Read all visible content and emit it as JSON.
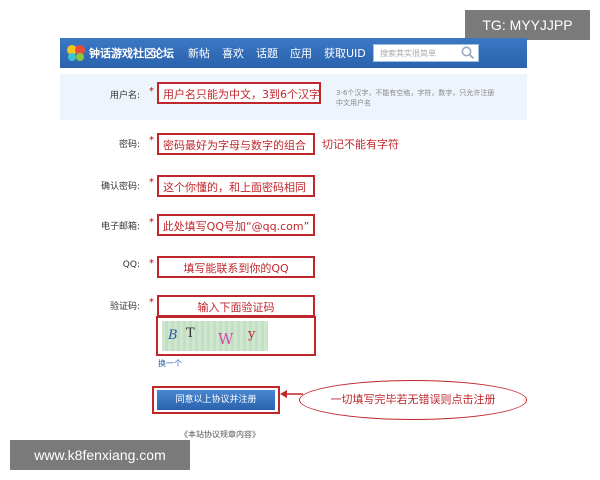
{
  "header": {
    "logo_text": "钟话游戏社区",
    "nav": [
      "论坛",
      "新帖",
      "喜欢",
      "话题",
      "应用",
      "获取UID"
    ],
    "search_placeholder": "搜索其实很简单"
  },
  "form": {
    "username": {
      "label": "用户名:",
      "required": "*",
      "value": "用户名只能为中文，3到6个汉字",
      "hint_line1": "3-6个汉字，不能有空格，字符，数字，只允许注册",
      "hint_line2": "中文用户名"
    },
    "password": {
      "label": "密码:",
      "required": "*",
      "value": "密码最好为字母与数字的组合",
      "note": "切记不能有字符"
    },
    "confirm_password": {
      "label": "确认密码:",
      "required": "*",
      "value": "这个你懂的，和上面密码相同"
    },
    "email": {
      "label": "电子邮箱:",
      "required": "*",
      "value": "此处填写QQ号加“@qq.com”"
    },
    "qq": {
      "label": "QQ:",
      "required": "*",
      "value": "填写能联系到你的QQ"
    },
    "captcha": {
      "label": "验证码:",
      "required": "*",
      "value": "输入下面验证码",
      "chars": [
        "B",
        "T",
        "W",
        "y"
      ],
      "refresh_label": "换一个"
    },
    "submit_label": "同意以上协议并注册",
    "terms_link": "《本站协议规章内容》"
  },
  "callout_text": "一切填写完毕若无错误则点击注册",
  "watermarks": {
    "top_right": "TG: MYYJJPP",
    "bottom_left": "www.k8fenxiang.com"
  },
  "colors": {
    "annotation_red": "#c0272d",
    "nav_blue": "#2a62ad",
    "highlight_row": "#eef4fb",
    "watermark_gray": "#7a7a7a"
  },
  "icons": {
    "logo": "butterfly-logo-icon",
    "search": "search-icon",
    "arrow": "arrow-left-icon"
  }
}
